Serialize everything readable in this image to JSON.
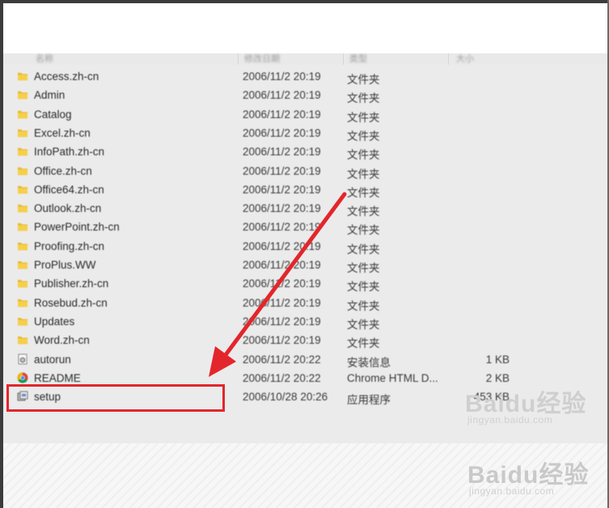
{
  "columns": {
    "name": "名称",
    "date": "修改日期",
    "type": "类型",
    "size": "大小"
  },
  "files": [
    {
      "name": "Access.zh-cn",
      "date": "2006/11/2 20:19",
      "type": "文件夹",
      "size": "",
      "icon": "folder-icon"
    },
    {
      "name": "Admin",
      "date": "2006/11/2 20:19",
      "type": "文件夹",
      "size": "",
      "icon": "folder-icon"
    },
    {
      "name": "Catalog",
      "date": "2006/11/2 20:19",
      "type": "文件夹",
      "size": "",
      "icon": "folder-icon"
    },
    {
      "name": "Excel.zh-cn",
      "date": "2006/11/2 20:19",
      "type": "文件夹",
      "size": "",
      "icon": "folder-icon"
    },
    {
      "name": "InfoPath.zh-cn",
      "date": "2006/11/2 20:19",
      "type": "文件夹",
      "size": "",
      "icon": "folder-icon"
    },
    {
      "name": "Office.zh-cn",
      "date": "2006/11/2 20:19",
      "type": "文件夹",
      "size": "",
      "icon": "folder-icon"
    },
    {
      "name": "Office64.zh-cn",
      "date": "2006/11/2 20:19",
      "type": "文件夹",
      "size": "",
      "icon": "folder-icon"
    },
    {
      "name": "Outlook.zh-cn",
      "date": "2006/11/2 20:19",
      "type": "文件夹",
      "size": "",
      "icon": "folder-icon"
    },
    {
      "name": "PowerPoint.zh-cn",
      "date": "2006/11/2 20:19",
      "type": "文件夹",
      "size": "",
      "icon": "folder-icon"
    },
    {
      "name": "Proofing.zh-cn",
      "date": "2006/11/2 20:19",
      "type": "文件夹",
      "size": "",
      "icon": "folder-icon"
    },
    {
      "name": "ProPlus.WW",
      "date": "2006/11/2 20:19",
      "type": "文件夹",
      "size": "",
      "icon": "folder-icon"
    },
    {
      "name": "Publisher.zh-cn",
      "date": "2006/11/2 20:19",
      "type": "文件夹",
      "size": "",
      "icon": "folder-icon"
    },
    {
      "name": "Rosebud.zh-cn",
      "date": "2006/11/2 20:19",
      "type": "文件夹",
      "size": "",
      "icon": "folder-icon"
    },
    {
      "name": "Updates",
      "date": "2006/11/2 20:19",
      "type": "文件夹",
      "size": "",
      "icon": "folder-icon"
    },
    {
      "name": "Word.zh-cn",
      "date": "2006/11/2 20:19",
      "type": "文件夹",
      "size": "",
      "icon": "folder-icon"
    },
    {
      "name": "autorun",
      "date": "2006/11/2 20:22",
      "type": "安装信息",
      "size": "1 KB",
      "icon": "settings-file-icon"
    },
    {
      "name": "README",
      "date": "2006/11/2 20:22",
      "type": "Chrome HTML D...",
      "size": "2 KB",
      "icon": "chrome-icon"
    },
    {
      "name": "setup",
      "date": "2006/10/28 20:26",
      "type": "应用程序",
      "size": "453 KB",
      "icon": "setup-app-icon"
    }
  ],
  "annotation": {
    "highlight_target": "setup",
    "color": "#e3262b"
  },
  "watermark": {
    "brand": "Baidu经验",
    "url": "jingyan.baidu.com"
  }
}
